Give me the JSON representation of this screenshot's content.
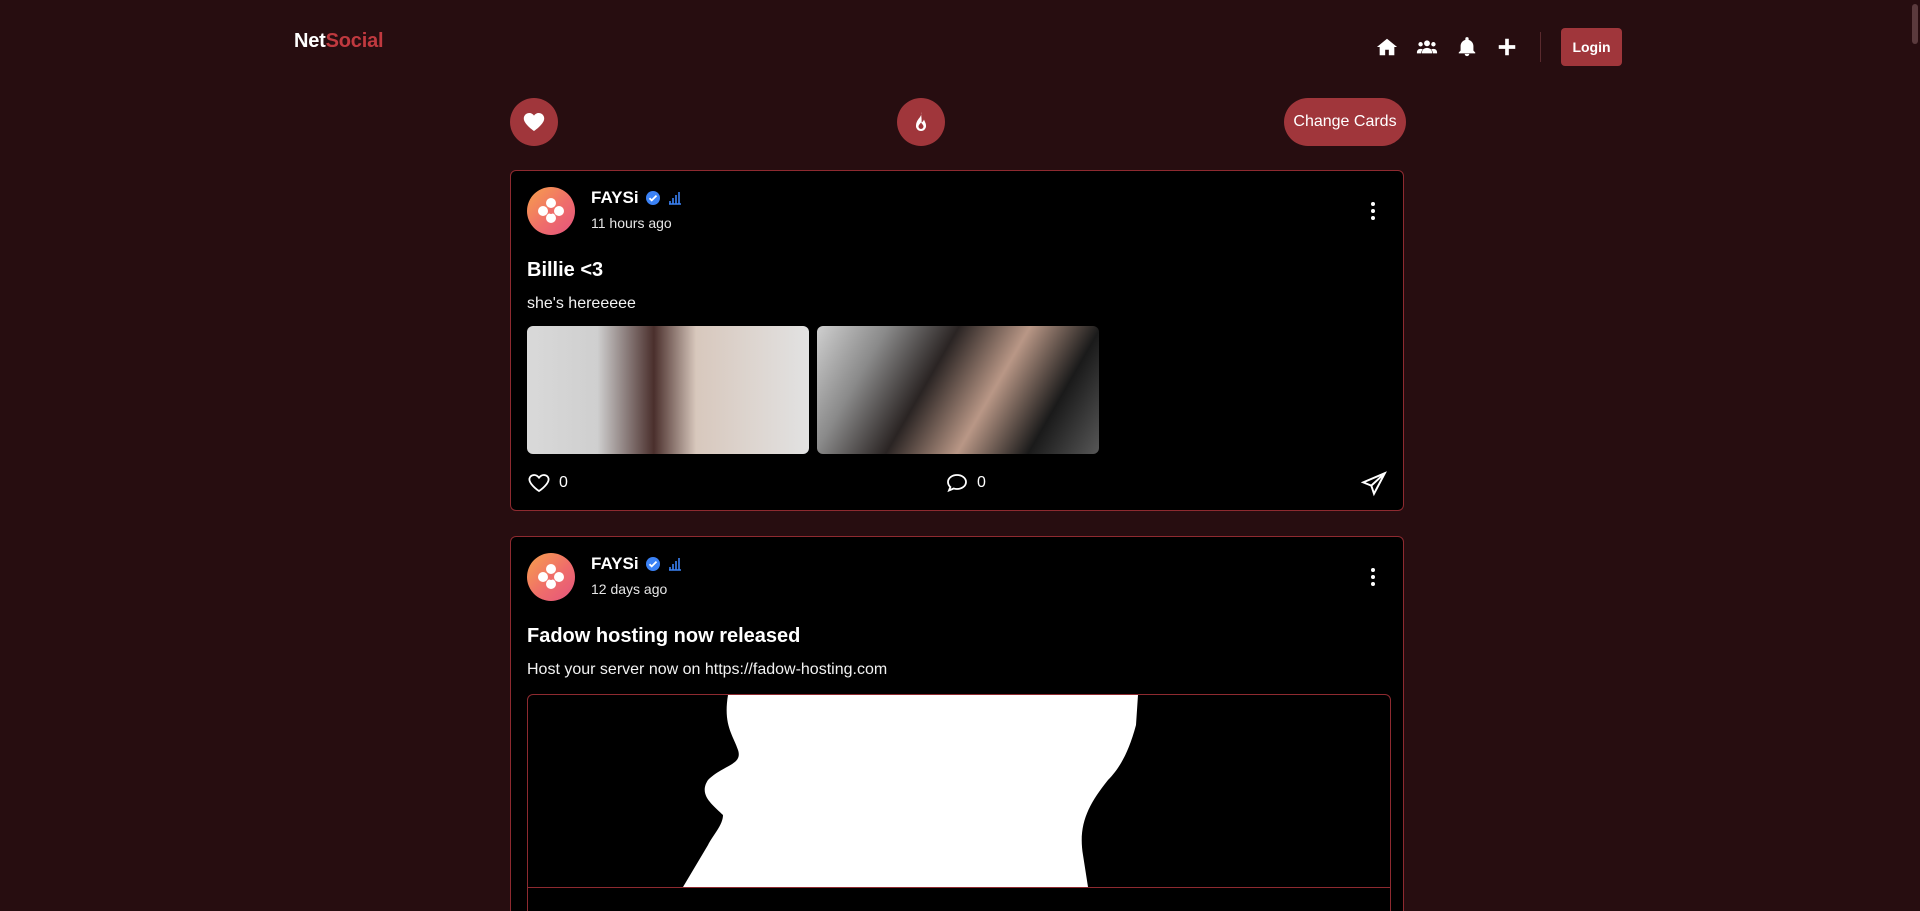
{
  "brand": {
    "part1": "Net",
    "part2": "Social"
  },
  "nav": {
    "icons": [
      "home-icon",
      "users-icon",
      "bell-icon",
      "plus-icon"
    ],
    "login_label": "Login"
  },
  "actions": {
    "like_icon": "heart-icon",
    "hot_icon": "fire-icon",
    "change_cards_label": "Change Cards"
  },
  "posts": [
    {
      "username": "FAYSi",
      "time": "11 hours ago",
      "title": "Billie <3",
      "text": "she's hereeeee",
      "likes": "0",
      "comments": "0",
      "images": [
        "photo-1",
        "photo-2"
      ]
    },
    {
      "username": "FAYSi",
      "time": "12 days ago",
      "title": "Fadow hosting now released",
      "text": "Host your server now on https://fadow-hosting.com"
    }
  ],
  "colors": {
    "background": "#270d10",
    "accent": "#a0363b",
    "card_border": "#8e2a30",
    "brand_accent": "#c0393f",
    "verified": "#3b82f6"
  }
}
